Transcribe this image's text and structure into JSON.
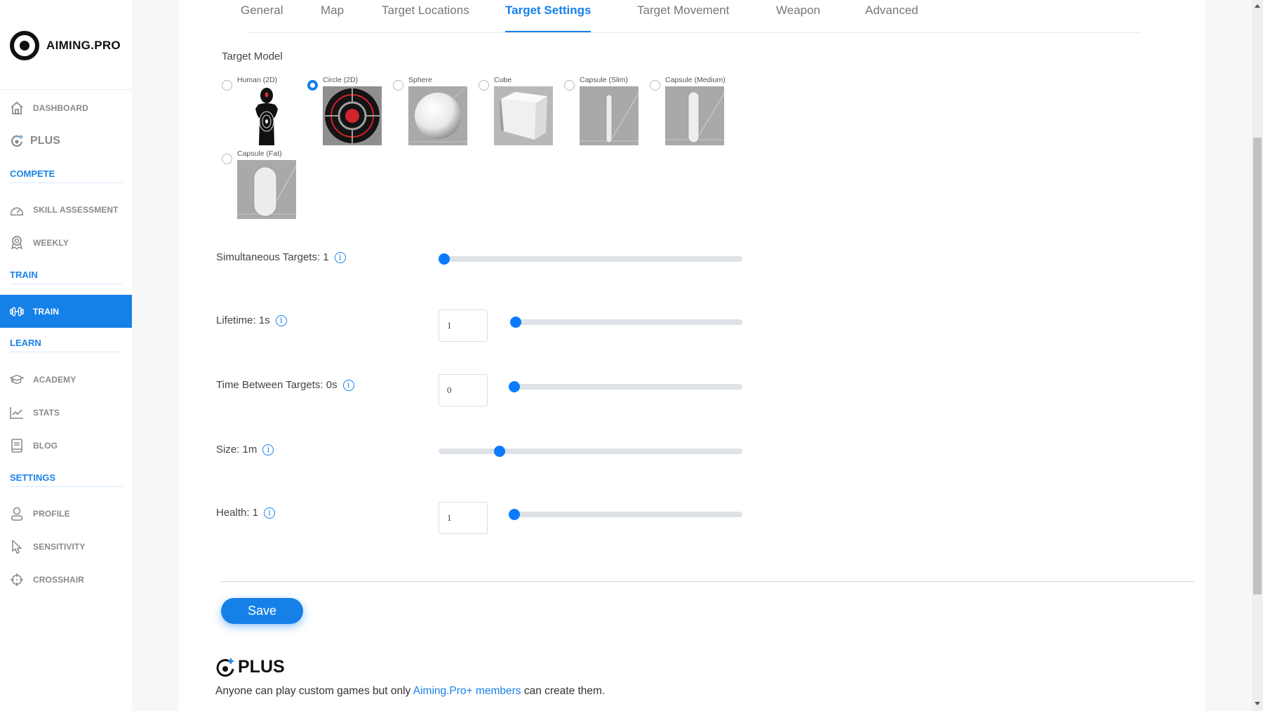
{
  "app": {
    "logo_text": "AIMING.PRO"
  },
  "sidebar": {
    "items": [
      {
        "id": "dashboard",
        "label": "DASHBOARD",
        "icon": "home-icon"
      },
      {
        "id": "plus",
        "label": "PLUS",
        "icon": "plus-target-icon"
      },
      {
        "id": "compete",
        "label": "COMPETE",
        "section": true
      },
      {
        "id": "skill-assessment",
        "label": "SKILL ASSESSMENT",
        "icon": "gauge-icon"
      },
      {
        "id": "weekly",
        "label": "WEEKLY",
        "icon": "award-icon"
      },
      {
        "id": "train-section",
        "label": "TRAIN",
        "section": true
      },
      {
        "id": "train",
        "label": "TRAIN",
        "icon": "dumbbell-icon",
        "active": true
      },
      {
        "id": "learn",
        "label": "LEARN",
        "section": true
      },
      {
        "id": "academy",
        "label": "ACADEMY",
        "icon": "graduation-cap-icon"
      },
      {
        "id": "stats",
        "label": "STATS",
        "icon": "chart-line-icon"
      },
      {
        "id": "blog",
        "label": "BLOG",
        "icon": "book-icon"
      },
      {
        "id": "settings",
        "label": "SETTINGS",
        "section": true
      },
      {
        "id": "profile",
        "label": "PROFILE",
        "icon": "user-icon"
      },
      {
        "id": "sensitivity",
        "label": "SENSITIVITY",
        "icon": "cursor-icon"
      },
      {
        "id": "crosshair",
        "label": "CROSSHAIR",
        "icon": "crosshair-icon"
      }
    ]
  },
  "tabs": [
    {
      "label": "General"
    },
    {
      "label": "Map"
    },
    {
      "label": "Target Locations"
    },
    {
      "label": "Target Settings",
      "active": true
    },
    {
      "label": "Target Movement"
    },
    {
      "label": "Weapon"
    },
    {
      "label": "Advanced"
    }
  ],
  "target_model": {
    "label": "Target Model",
    "selected": "Circle (2D)",
    "options": [
      {
        "label": "Human (2D)",
        "checked": false
      },
      {
        "label": "Circle (2D)",
        "checked": true
      },
      {
        "label": "Sphere",
        "checked": false
      },
      {
        "label": "Cube",
        "checked": false
      },
      {
        "label": "Capsule (Slim)",
        "checked": false
      },
      {
        "label": "Capsule (Medium)",
        "checked": false
      },
      {
        "label": "Capsule (Fat)",
        "checked": false
      }
    ]
  },
  "settings": {
    "simultaneous_targets": {
      "label": "Simultaneous Targets: 1",
      "value": 1,
      "slider_fraction": 0.0
    },
    "lifetime": {
      "label": "Lifetime: 1s",
      "input_value": "1",
      "slider_fraction": 0.0
    },
    "time_between_targets": {
      "label": "Time Between Targets: 0s",
      "input_value": "0",
      "slider_fraction": 0.0
    },
    "size": {
      "label": "Size: 1m",
      "slider_fraction": 0.19
    },
    "health": {
      "label": "Health: 1",
      "input_value": "1",
      "slider_fraction": 0.0
    },
    "info_glyph": "i"
  },
  "actions": {
    "save_label": "Save"
  },
  "plus_promo": {
    "title": "PLUS",
    "text_before": "Anyone can play custom games but only ",
    "link_text": "Aiming.Pro+ members",
    "text_after": " can create them."
  },
  "colors": {
    "accent": "#1580e8",
    "slider_thumb": "#0a7bff",
    "track": "#dee1e6"
  }
}
